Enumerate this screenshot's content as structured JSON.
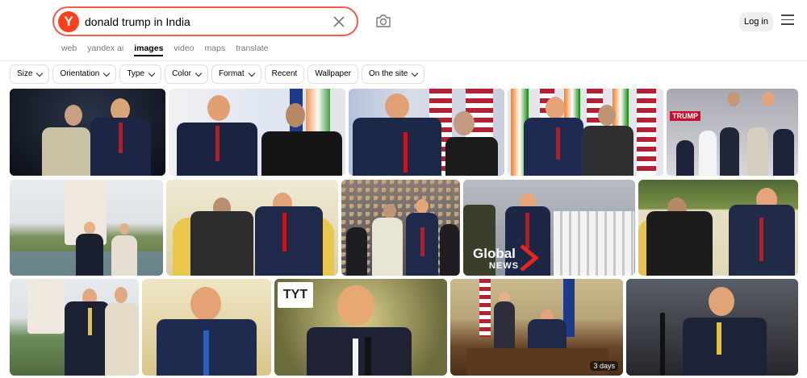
{
  "header": {
    "logo_letter": "Y",
    "search_value": "donald trump in India",
    "login_label": "Log in"
  },
  "nav": {
    "tabs": [
      {
        "label": "web"
      },
      {
        "label": "yandex ai"
      },
      {
        "label": "images",
        "active": true
      },
      {
        "label": "video"
      },
      {
        "label": "maps"
      },
      {
        "label": "translate"
      }
    ]
  },
  "filters": [
    {
      "label": "Size",
      "dropdown": true
    },
    {
      "label": "Orientation",
      "dropdown": true
    },
    {
      "label": "Type",
      "dropdown": true
    },
    {
      "label": "Color",
      "dropdown": true
    },
    {
      "label": "Format",
      "dropdown": true
    },
    {
      "label": "Recent",
      "dropdown": false
    },
    {
      "label": "Wallpaper",
      "dropdown": false
    },
    {
      "label": "On the site",
      "dropdown": true
    }
  ],
  "results": {
    "overlays": {
      "global_news_line1": "Global",
      "global_news_line2": "NEWS",
      "tyt": "TYT",
      "trump_sign": "TRUMP",
      "duration": "3 days"
    }
  },
  "colors": {
    "accent": "#fc3f1d",
    "search_border": "#f35b4e"
  }
}
